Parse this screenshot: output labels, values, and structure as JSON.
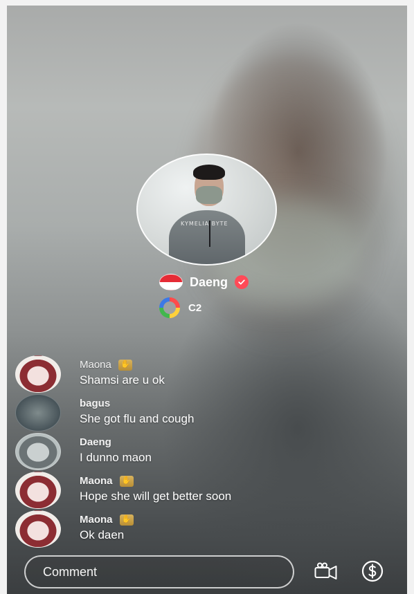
{
  "host": {
    "name": "Daeng",
    "rank": "C2",
    "flag_color_top": "#e52b35",
    "flag_color_bottom": "#ffffff",
    "verified_color": "#ff4a57",
    "avatar_logo_text": "KYMELIA BYTE"
  },
  "chat": {
    "messages": [
      {
        "user": "Maona",
        "text": "Shamsi are u ok",
        "badge": "wave-badge"
      },
      {
        "user": "bagus",
        "text": "She got flu and cough",
        "badge": ""
      },
      {
        "user": "Daeng",
        "text": "I dunno maon",
        "badge": ""
      },
      {
        "user": "Maona",
        "text": "Hope she will get better soon",
        "badge": "wave-badge"
      },
      {
        "user": "Maona",
        "text": "Ok daen",
        "badge": "wave-badge"
      }
    ]
  },
  "composer": {
    "placeholder": "Comment"
  },
  "icons": {
    "camera": "video-camera-icon",
    "coin": "dollar-coin-icon",
    "verified": "verified-check-icon",
    "badge": "hand-wave-icon",
    "rank": "rank-ring-icon"
  }
}
